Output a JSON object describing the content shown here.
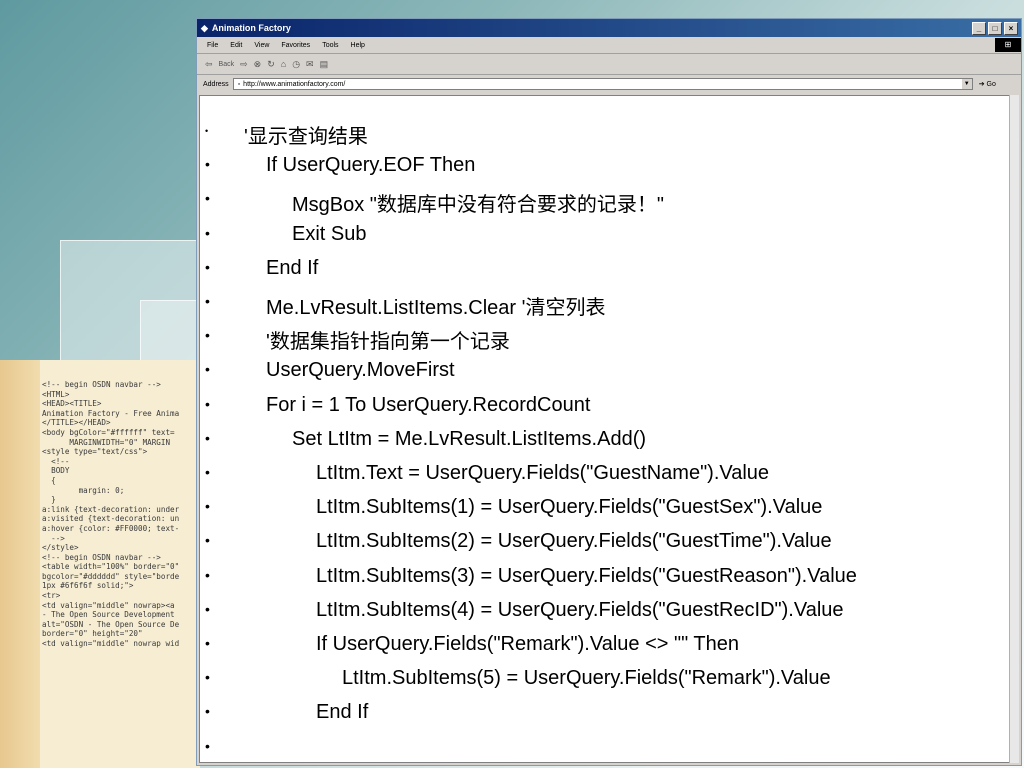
{
  "browser": {
    "title": "Animation Factory",
    "menu": [
      "File",
      "Edit",
      "View",
      "Favorites",
      "Tools",
      "Help"
    ],
    "toolbar_back": "Back",
    "address_label": "Address",
    "address_value": "http://www.animationfactory.com/",
    "go_label": "Go"
  },
  "slide": {
    "bullet": "•",
    "lines": [
      {
        "text": "'显示查询结果",
        "indent": 0
      },
      {
        "text": "If UserQuery.EOF Then",
        "indent": 1
      },
      {
        "text": "MsgBox \"数据库中没有符合要求的记录！\"",
        "indent": 2
      },
      {
        "text": "Exit Sub",
        "indent": 2
      },
      {
        "text": "End If",
        "indent": 1
      },
      {
        "text": "Me.LvResult.ListItems.Clear '清空列表",
        "indent": 1
      },
      {
        "text": "'数据集指针指向第一个记录",
        "indent": 1
      },
      {
        "text": "UserQuery.MoveFirst",
        "indent": 1
      },
      {
        "text": "For i = 1 To UserQuery.RecordCount",
        "indent": 1
      },
      {
        "text": "Set LtItm = Me.LvResult.ListItems.Add()",
        "indent": 2
      },
      {
        "text": "LtItm.Text = UserQuery.Fields(\"GuestName\").Value",
        "indent": 3
      },
      {
        "text": "LtItm.SubItems(1) = UserQuery.Fields(\"GuestSex\").Value",
        "indent": 3
      },
      {
        "text": "LtItm.SubItems(2) = UserQuery.Fields(\"GuestTime\").Value",
        "indent": 3
      },
      {
        "text": "LtItm.SubItems(3) = UserQuery.Fields(\"GuestReason\").Value",
        "indent": 3
      },
      {
        "text": "LtItm.SubItems(4) = UserQuery.Fields(\"GuestRecID\").Value",
        "indent": 3
      },
      {
        "text": "If UserQuery.Fields(\"Remark\").Value <> \"\" Then",
        "indent": 3
      },
      {
        "text": "LtItm.SubItems(5) = UserQuery.Fields(\"Remark\").Value",
        "indent": 4
      },
      {
        "text": "End If",
        "indent": 3
      },
      {
        "text": "",
        "indent": 0
      }
    ]
  },
  "background_code": [
    "<!-- begin OSDN navbar -->",
    "<HTML>",
    "<HEAD><TITLE>",
    "Animation Factory - Free Anima",
    "</TITLE></HEAD>",
    "<body bgColor=\"#ffffff\" text=",
    "      MARGINWIDTH=\"0\" MARGIN",
    "",
    "<style type=\"text/css\">",
    "  <!--",
    "  BODY",
    "  {",
    "        margin: 0;",
    "  }",
    "",
    "a:link {text-decoration: under",
    "a:visited {text-decoration: un",
    "a:hover {color: #FF0000; text-",
    "  -->",
    "</style>",
    "",
    "<!-- begin OSDN navbar -->",
    "<table width=\"100%\" border=\"0\"",
    "bgcolor=\"#dddddd\" style=\"borde",
    "1px #6f6f6f solid;\">",
    "<tr>",
    "<td valign=\"middle\" nowrap><a",
    "- The Open Source Development",
    "alt=\"OSDN - The Open Source De",
    "border=\"0\" height=\"20\"",
    "<td valign=\"middle\" nowrap wid"
  ]
}
